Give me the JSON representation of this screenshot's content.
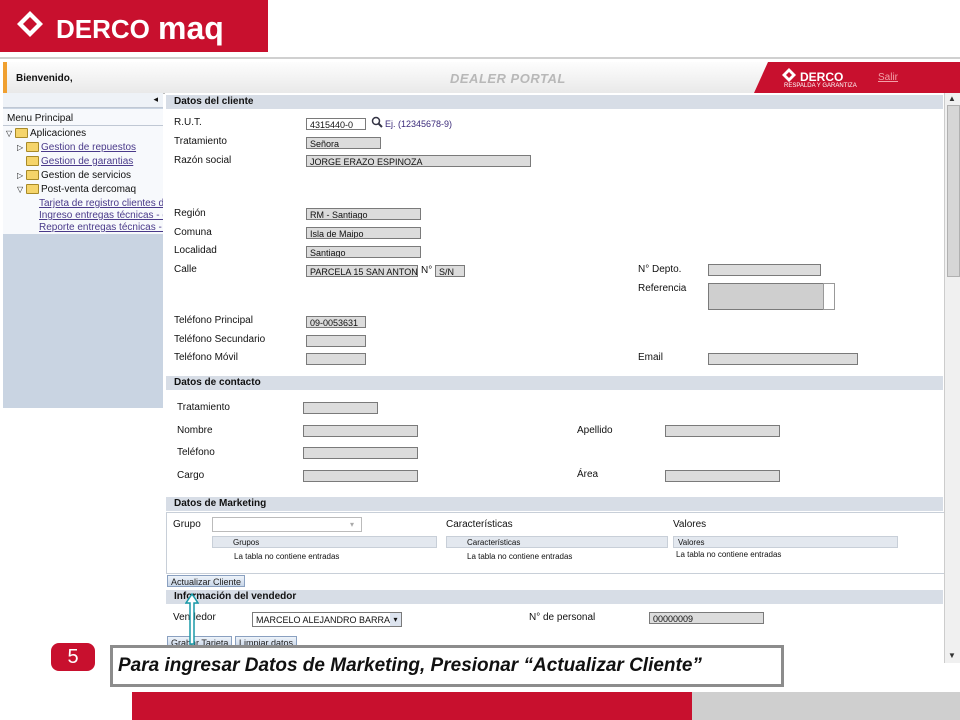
{
  "logo": {
    "text_derco": "DERCO",
    "text_maq": "maq"
  },
  "header": {
    "welcome": "Bienvenido,",
    "title": "DEALER PORTAL",
    "dealer_logo": "DERCO",
    "dealer_tagline": "RESPALDA Y GARANTIZA",
    "logout": "Salir"
  },
  "sidebar": {
    "title": "Menu Principal",
    "items": [
      {
        "label": "Aplicaciones"
      },
      {
        "label": "Gestion de repuestos"
      },
      {
        "label": "Gestion de garantias"
      },
      {
        "label": "Gestion de servicios"
      },
      {
        "label": "Post-venta dercomaq"
      },
      {
        "label": "Tarjeta de registro clientes d"
      },
      {
        "label": "Ingreso entregas técnicas - d"
      },
      {
        "label": "Reporte entregas técnicas - d"
      }
    ]
  },
  "cliente": {
    "section": "Datos del cliente",
    "rut_label": "R.U.T.",
    "rut_value": "4315440-0",
    "rut_hint": "Ej. (12345678-9)",
    "tratamiento_label": "Tratamiento",
    "tratamiento_value": "Señora",
    "razon_label": "Razón social",
    "razon_value": "JORGE ERAZO ESPINOZA",
    "region_label": "Región",
    "region_value": "RM - Santiago",
    "comuna_label": "Comuna",
    "comuna_value": "Isla de Maipo",
    "localidad_label": "Localidad",
    "localidad_value": "Santiago",
    "calle_label": "Calle",
    "calle_value": "PARCELA 15 SAN ANTONIO",
    "numero_label": "N°",
    "numero_value": "S/N",
    "depto_label": "N° Depto.",
    "referencia_label": "Referencia",
    "tel_principal_label": "Teléfono Principal",
    "tel_principal_value": "09-0053631",
    "tel_secundario_label": "Teléfono Secundario",
    "tel_movil_label": "Teléfono Móvil",
    "email_label": "Email"
  },
  "contacto": {
    "section": "Datos de contacto",
    "tratamiento_label": "Tratamiento",
    "nombre_label": "Nombre",
    "apellido_label": "Apellido",
    "telefono_label": "Teléfono",
    "cargo_label": "Cargo",
    "area_label": "Área"
  },
  "marketing": {
    "section": "Datos de Marketing",
    "grupo_label": "Grupo",
    "caracteristicas_label": "Características",
    "valores_label": "Valores",
    "grid_grupos_header": "Grupos",
    "grid_caracteristicas_header": "Características",
    "grid_valores_header": "Valores",
    "empty_text": "La tabla no contiene entradas"
  },
  "actions": {
    "actualizar": "Actualizar Cliente",
    "grabar": "Grabar Tarjeta",
    "limpiar": "Limpiar datos"
  },
  "vendedor": {
    "section": "Información del vendedor",
    "vendedor_label": "Vendedor",
    "vendedor_value": "MARCELO ALEJANDRO BARRA",
    "personal_label": "N° de personal",
    "personal_value": "00000009"
  },
  "annotation": {
    "step": "5",
    "text": "Para ingresar Datos de Marketing,  Presionar “Actualizar Cliente”"
  }
}
